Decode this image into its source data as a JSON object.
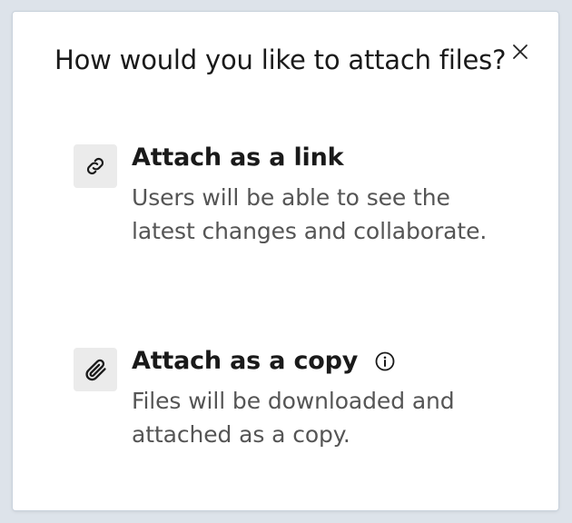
{
  "dialog": {
    "title": "How would you like to attach files?",
    "close_icon": "close-icon"
  },
  "options": [
    {
      "icon": "link-icon",
      "heading": "Attach as a link",
      "description": "Users will be able to see the latest changes and collaborate."
    },
    {
      "icon": "paperclip-icon",
      "heading": "Attach as a copy",
      "info_icon": "info-icon",
      "description": "Files will be downloaded and attached as a copy."
    }
  ],
  "colors": {
    "title_text": "#1a1a1a",
    "description_text": "#555555",
    "icon_tile": "#ebebeb",
    "backdrop": "#dde3ea"
  }
}
